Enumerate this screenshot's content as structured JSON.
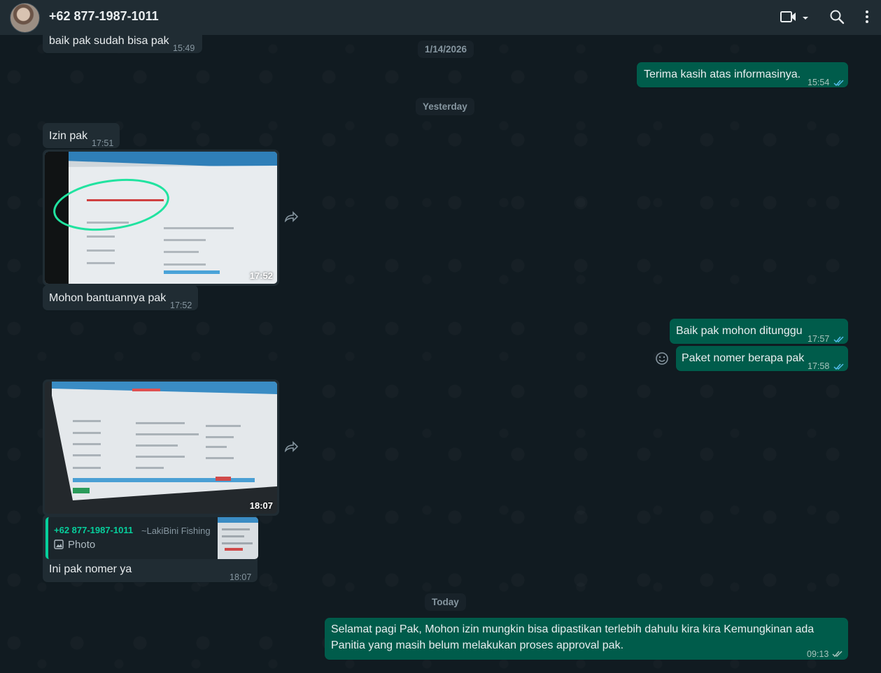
{
  "header": {
    "contact": "+62 877-1987-1011"
  },
  "dates": {
    "d1": "1/14/2026",
    "d2": "Yesterday",
    "d3": "Today"
  },
  "messages": {
    "m0": {
      "text": "baik pak sudah bisa pak",
      "time": "15:49"
    },
    "m1": {
      "text": "Terima kasih atas informasinya.",
      "time": "15:54"
    },
    "m2": {
      "text": "Izin pak",
      "time": "17:51"
    },
    "m3": {
      "time": "17:52"
    },
    "m4": {
      "text": "Mohon bantuannya pak",
      "time": "17:52"
    },
    "m5": {
      "text": "Baik pak mohon ditunggu",
      "time": "17:57"
    },
    "m6": {
      "text": "Paket nomer berapa pak",
      "time": "17:58"
    },
    "m7": {
      "time": "18:07"
    },
    "m8": {
      "quote_sender": "+62 877-1987-1011",
      "quote_group": "~LakiBini Fishing",
      "quote_label": "Photo",
      "text": "Ini pak nomer ya",
      "time": "18:07"
    },
    "m9": {
      "line1": "Selamat pagi Pak, Mohon izin mungkin bisa dipastikan terlebih dahulu kira kira Kemungkinan ada",
      "line2": "Panitia yang masih belum melakukan proses approval pak.",
      "time": "09:13"
    }
  },
  "colors": {
    "header_bg": "#202c33",
    "incoming_bubble": "#202c33",
    "outgoing_bubble": "#005c4b",
    "read_ticks": "#53bdeb",
    "quote_accent": "#06cf9c"
  }
}
